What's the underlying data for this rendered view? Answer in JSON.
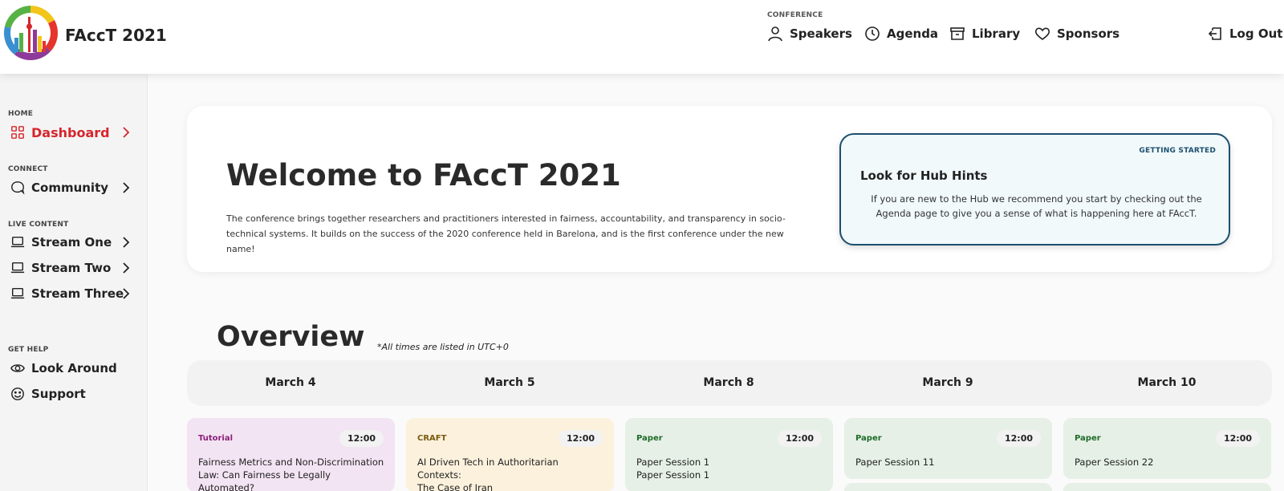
{
  "header": {
    "brand": "FAccT 2021",
    "conference_label": "CONFERENCE",
    "nav": [
      {
        "label": "Speakers",
        "icon": "person-icon"
      },
      {
        "label": "Agenda",
        "icon": "clock-icon"
      },
      {
        "label": "Library",
        "icon": "archive-icon"
      },
      {
        "label": "Sponsors",
        "icon": "heart-icon"
      }
    ],
    "logout": {
      "label": "Log Out",
      "icon": "logout-icon"
    }
  },
  "sidebar": {
    "sections": [
      {
        "label": "HOME",
        "items": [
          {
            "label": "Dashboard",
            "icon": "grid-icon",
            "active": true
          }
        ]
      },
      {
        "label": "CONNECT",
        "items": [
          {
            "label": "Community",
            "icon": "chat-bubble-icon"
          }
        ]
      },
      {
        "label": "LIVE CONTENT",
        "items": [
          {
            "label": "Stream One",
            "icon": "laptop-icon"
          },
          {
            "label": "Stream Two",
            "icon": "laptop-icon"
          },
          {
            "label": "Stream Three",
            "icon": "laptop-icon"
          }
        ]
      },
      {
        "label": "GET HELP",
        "items": [
          {
            "label": "Look Around",
            "icon": "eye-icon"
          },
          {
            "label": "Support",
            "icon": "smiley-icon"
          }
        ]
      }
    ]
  },
  "welcome": {
    "title": "Welcome to FAccT 2021",
    "description": "The conference brings together researchers and practitioners interested in fairness, accountability, and transparency in socio-technical systems. It builds on the success of the 2020 conference held in Barelona, and is the first conference under the new name!"
  },
  "hint": {
    "tag": "GETTING STARTED",
    "title": "Look for Hub Hints",
    "body": "If you are new to the Hub we recommend you start by checking out the Agenda page to give you a sense of what is happening here at FAccT."
  },
  "overview": {
    "title": "Overview",
    "note": "*All times are listed in UTC+0",
    "days": [
      "March 4",
      "March 5",
      "March 8",
      "March 9",
      "March 10"
    ],
    "sessions": [
      {
        "kind": "Tutorial",
        "time": "12:00",
        "lines": [
          "Fairness Metrics and Non-Discrimination",
          "Law: Can Fairness be Legally Automated?"
        ]
      },
      {
        "kind": "CRAFT",
        "time": "12:00",
        "lines": [
          "AI Driven Tech in Authoritarian Contexts:",
          "The Case of Iran"
        ]
      },
      {
        "kind": "Paper",
        "time": "12:00",
        "lines": [
          "Paper Session 1",
          "Paper Session 1"
        ]
      },
      {
        "kind": "Paper",
        "time": "12:00",
        "lines": [
          "Paper Session 11"
        ]
      },
      {
        "kind": "Paper",
        "time": "12:00",
        "lines": [
          "Paper Session 22"
        ]
      }
    ]
  },
  "colors": {
    "accent": "#d6262c",
    "hint_border": "#1d4f6e",
    "tutorial_bg": "#f3e4f3",
    "tutorial_text": "#8a1f7a",
    "craft_bg": "#fbf1dc",
    "craft_text": "#7a5a10",
    "paper_bg": "#e6f0e6",
    "paper_text": "#1e6b2a"
  }
}
